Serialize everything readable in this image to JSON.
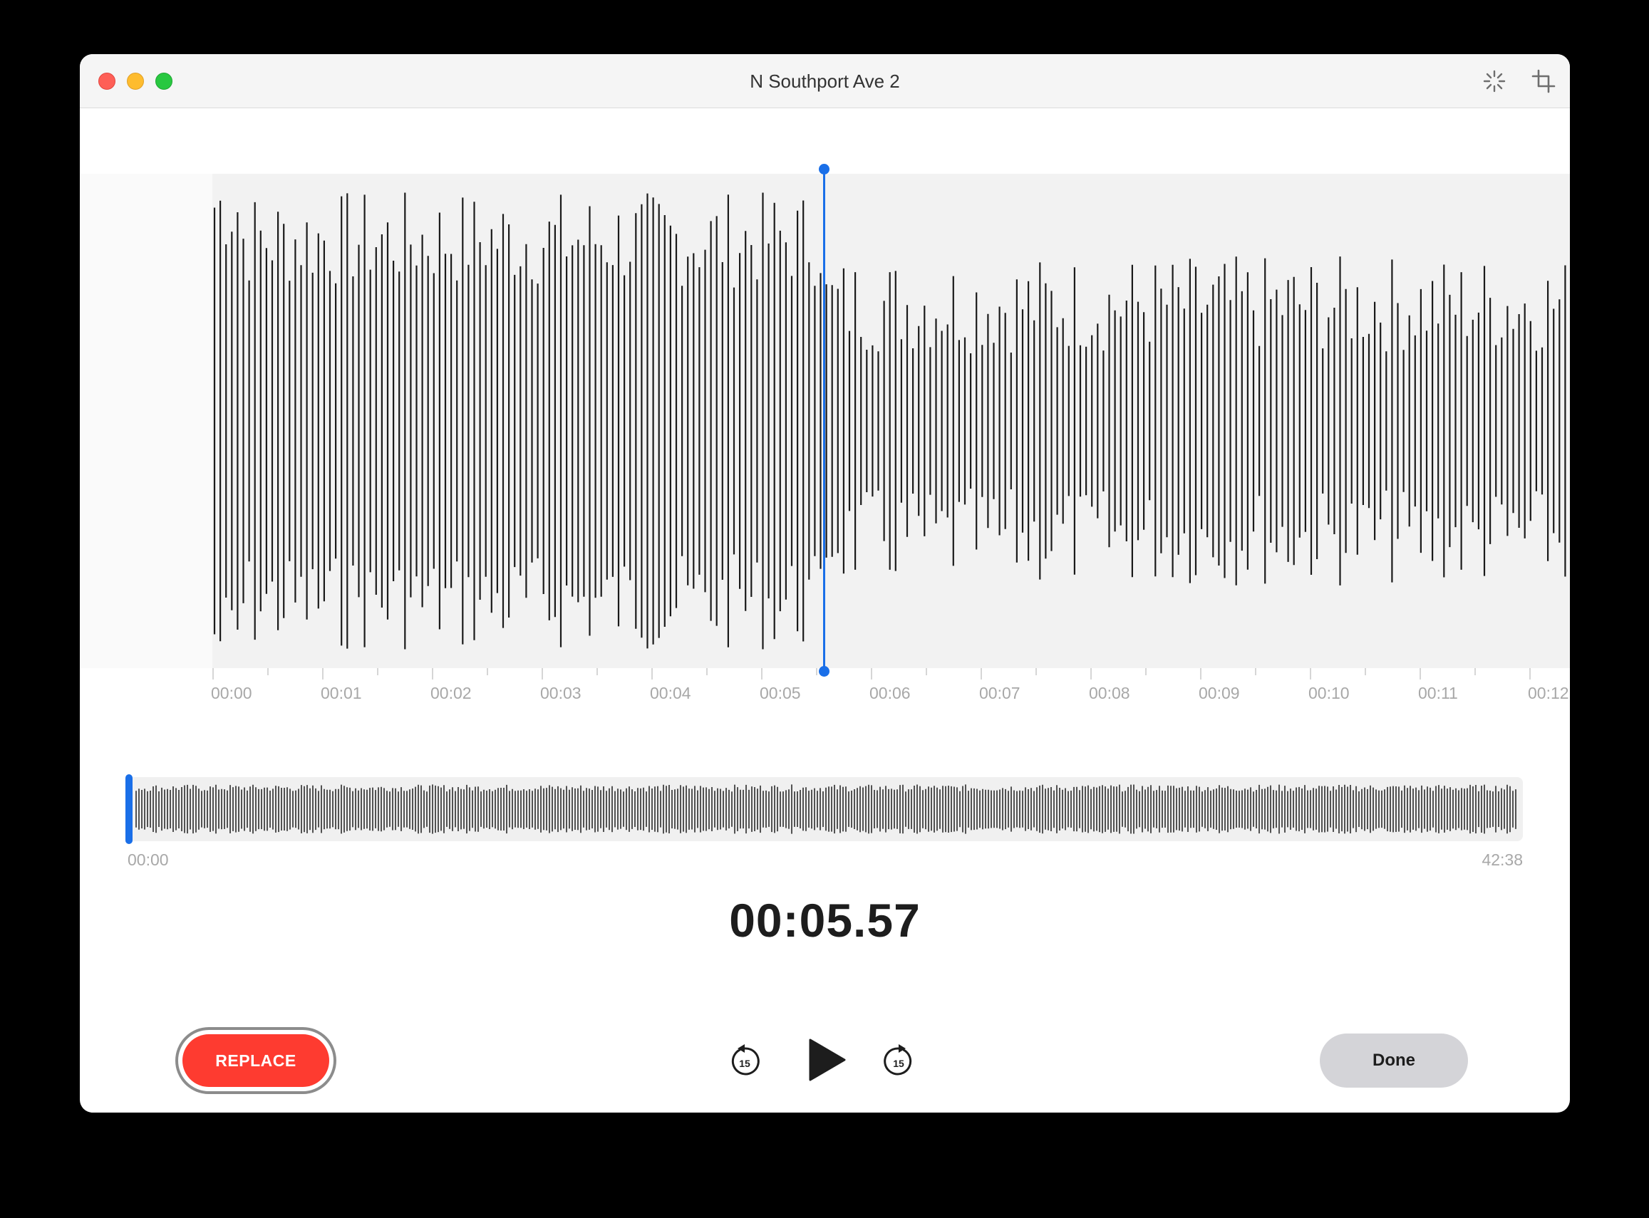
{
  "window": {
    "title": "N Southport Ave 2"
  },
  "titlebar": {
    "icons": [
      "enhance-recording-icon",
      "trim-icon"
    ]
  },
  "waveform": {
    "ruler_labels": [
      "00:00",
      "00:01",
      "00:02",
      "00:03",
      "00:04",
      "00:05",
      "00:06",
      "00:07",
      "00:08",
      "00:09",
      "00:10",
      "00:11",
      "00:12"
    ],
    "playhead_time": "00:05.57"
  },
  "overview": {
    "start_time": "00:00",
    "end_time": "42:38"
  },
  "current_time": "00:05.57",
  "controls": {
    "replace_label": "REPLACE",
    "skip_back_label": "15",
    "skip_forward_label": "15",
    "done_label": "Done"
  },
  "colors": {
    "accent_blue": "#1a6fe8",
    "replace_red": "#fe3b30",
    "waveform_bar": "#1a1a1a"
  }
}
